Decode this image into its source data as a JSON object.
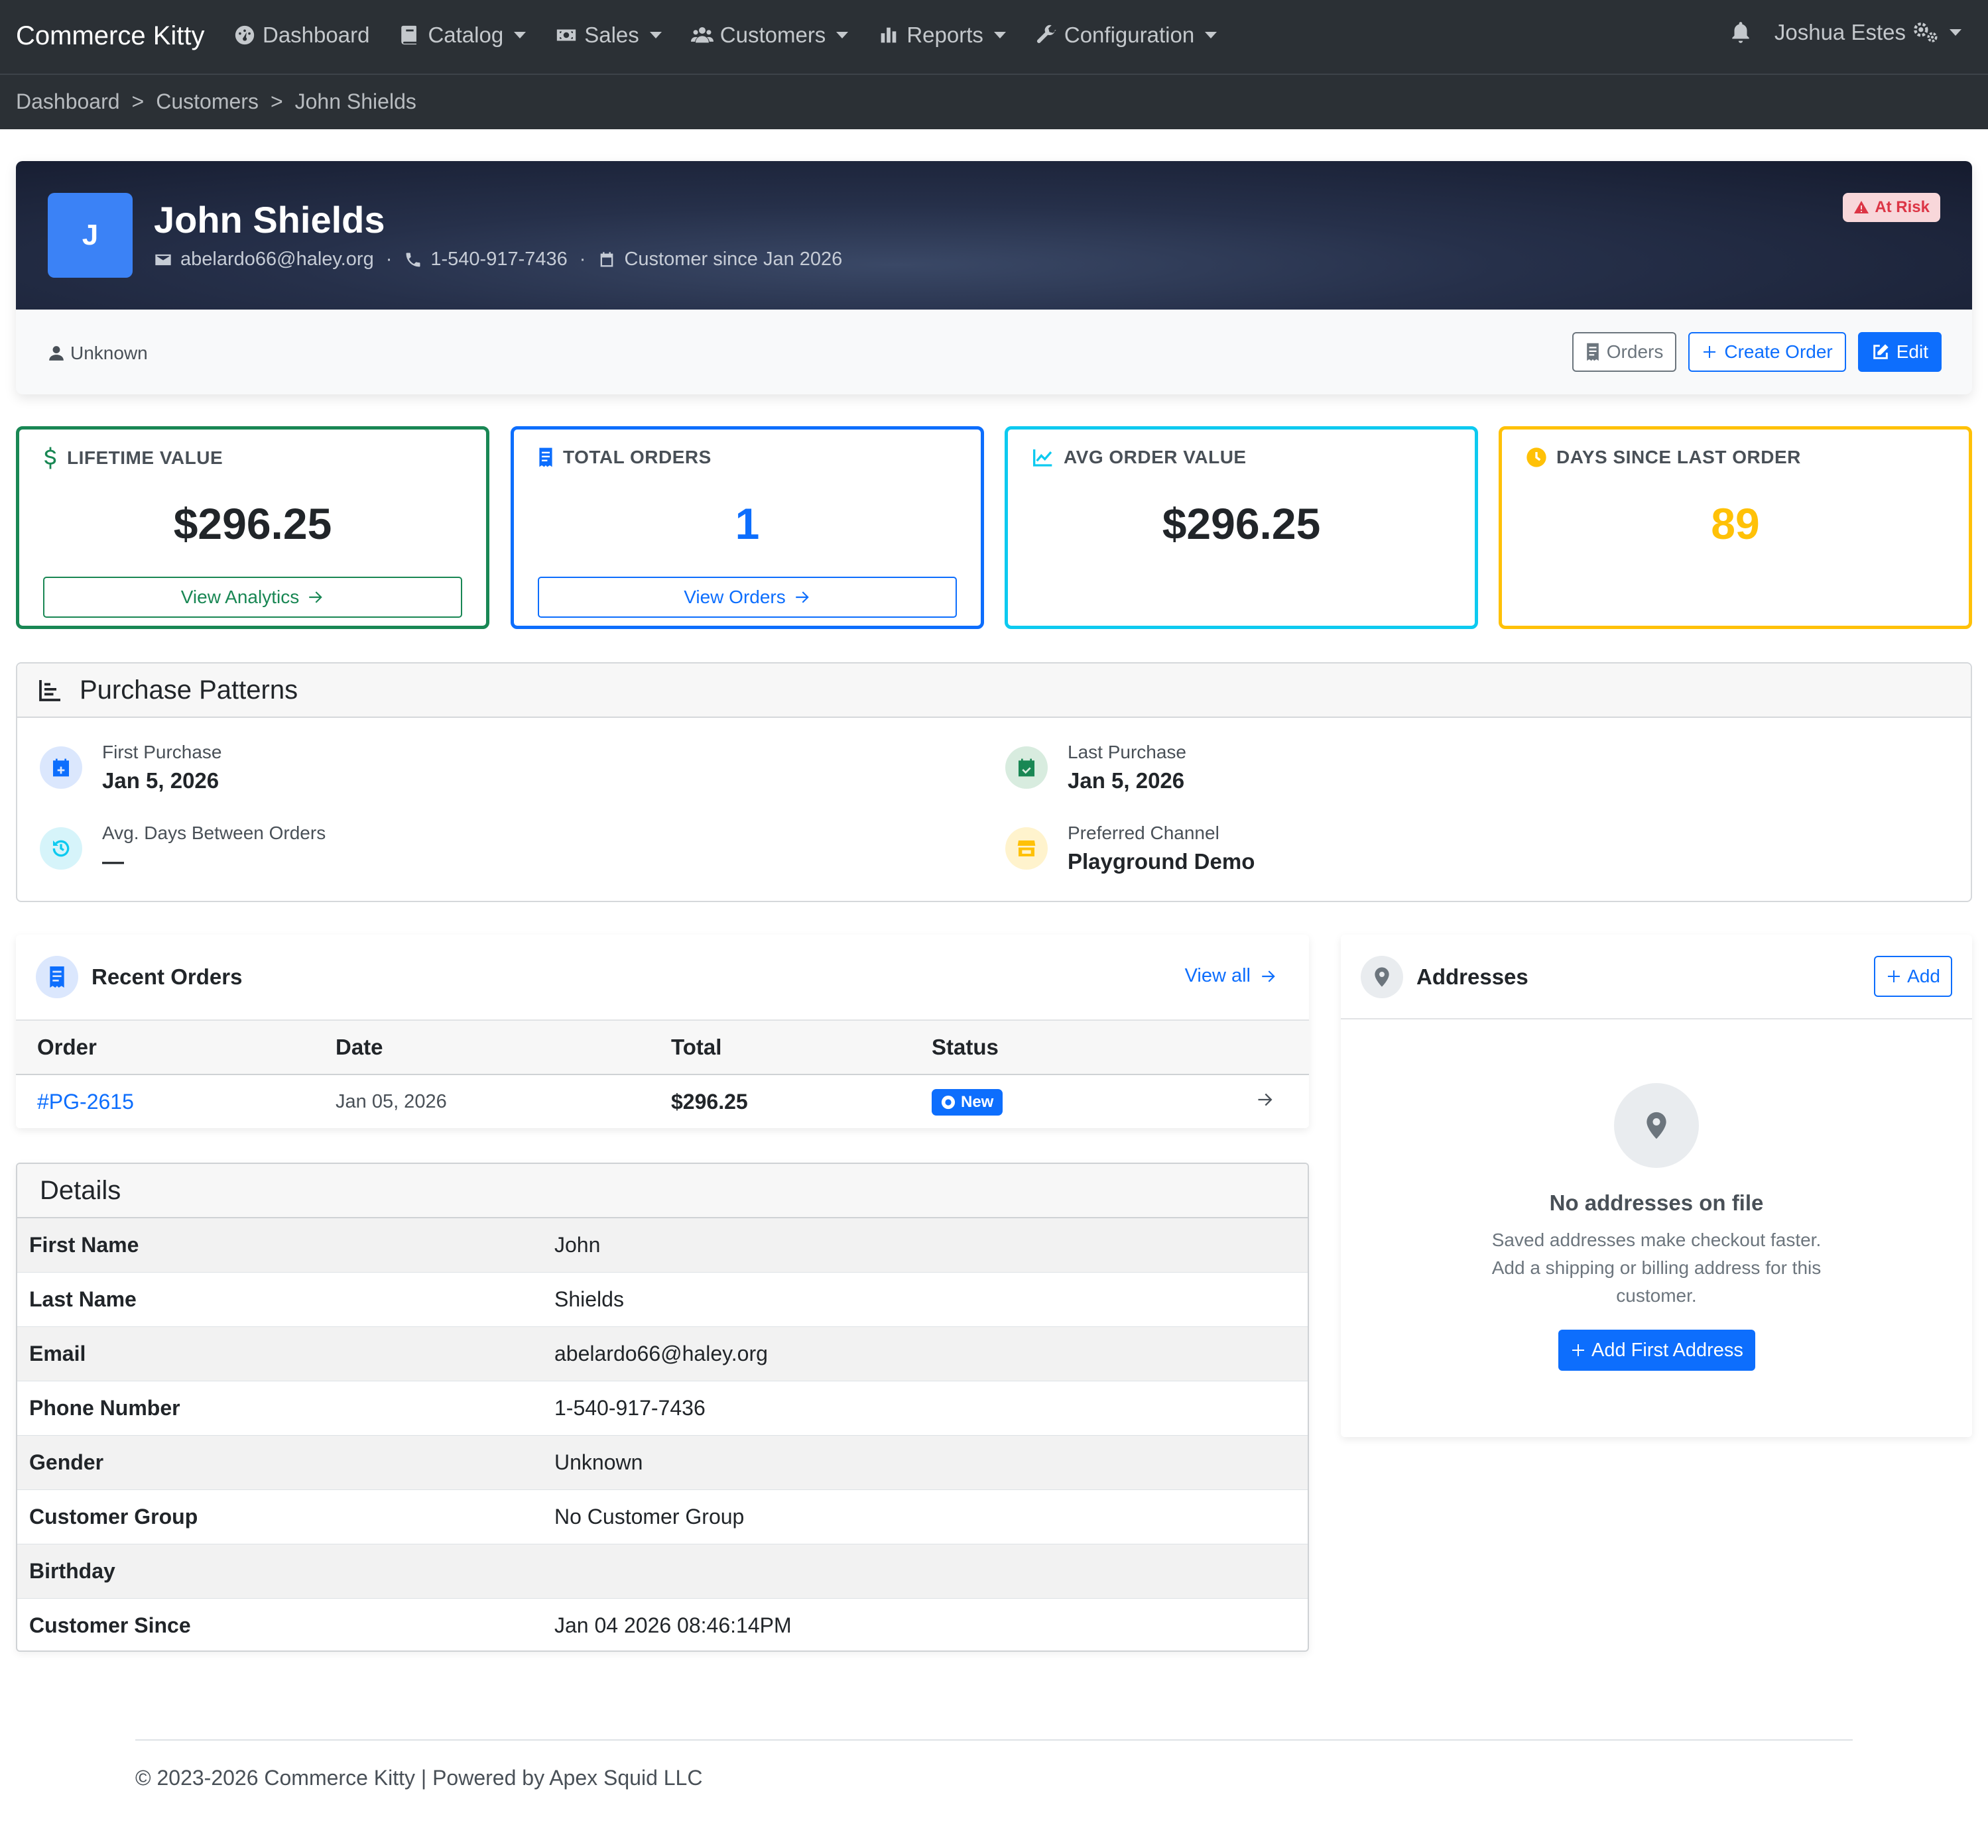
{
  "nav": {
    "brand": "Commerce Kitty",
    "items": [
      {
        "label": "Dashboard",
        "icon": "dashboard-icon",
        "dropdown": false
      },
      {
        "label": "Catalog",
        "icon": "book-icon",
        "dropdown": true
      },
      {
        "label": "Sales",
        "icon": "money-icon",
        "dropdown": true
      },
      {
        "label": "Customers",
        "icon": "users-icon",
        "dropdown": true
      },
      {
        "label": "Reports",
        "icon": "bar-chart-icon",
        "dropdown": true
      },
      {
        "label": "Configuration",
        "icon": "wrench-icon",
        "dropdown": true
      }
    ],
    "user": "Joshua Estes"
  },
  "breadcrumb": [
    "Dashboard",
    ">",
    "Customers",
    ">",
    "John Shields"
  ],
  "customer": {
    "initial": "J",
    "name": "John Shields",
    "email": "abelardo66@haley.org",
    "phone": "1-540-917-7436",
    "since": "Customer since Jan 2026",
    "risk_badge": "At Risk",
    "gender": "Unknown"
  },
  "actions": {
    "orders": "Orders",
    "create_order": "Create Order",
    "edit": "Edit"
  },
  "stats": [
    {
      "label": "LIFETIME VALUE",
      "value": "$296.25",
      "button": "View Analytics",
      "color": "#198754"
    },
    {
      "label": "TOTAL ORDERS",
      "value": "1",
      "button": "View Orders",
      "color": "#0d6efd"
    },
    {
      "label": "AVG ORDER VALUE",
      "value": "$296.25",
      "button": "",
      "color": "#0dcaf0"
    },
    {
      "label": "DAYS SINCE LAST ORDER",
      "value": "89",
      "button": "",
      "color": "#ffc107"
    }
  ],
  "patterns": {
    "title": "Purchase Patterns",
    "first_purchase": {
      "label": "First Purchase",
      "value": "Jan 5, 2026"
    },
    "last_purchase": {
      "label": "Last Purchase",
      "value": "Jan 5, 2026"
    },
    "avg_days": {
      "label": "Avg. Days Between Orders",
      "value": "—"
    },
    "channel": {
      "label": "Preferred Channel",
      "value": "Playground Demo"
    }
  },
  "recent_orders": {
    "title": "Recent Orders",
    "view_all": "View all",
    "columns": [
      "Order",
      "Date",
      "Total",
      "Status"
    ],
    "rows": [
      {
        "order": "#PG-2615",
        "date": "Jan 05, 2026",
        "total": "$296.25",
        "status": "New"
      }
    ]
  },
  "details": {
    "title": "Details",
    "rows": [
      {
        "k": "First Name",
        "v": "John"
      },
      {
        "k": "Last Name",
        "v": "Shields"
      },
      {
        "k": "Email",
        "v": "abelardo66@haley.org"
      },
      {
        "k": "Phone Number",
        "v": "1-540-917-7436"
      },
      {
        "k": "Gender",
        "v": "Unknown"
      },
      {
        "k": "Customer Group",
        "v": "No Customer Group"
      },
      {
        "k": "Birthday",
        "v": ""
      },
      {
        "k": "Customer Since",
        "v": "Jan 04 2026 08:46:14PM"
      }
    ]
  },
  "addresses": {
    "title": "Addresses",
    "add": "Add",
    "empty_title": "No addresses on file",
    "empty_text": "Saved addresses make checkout faster. Add a shipping or billing address for this customer.",
    "empty_button": "Add First Address"
  },
  "footer": "© 2023-2026 Commerce Kitty | Powered by Apex Squid LLC"
}
